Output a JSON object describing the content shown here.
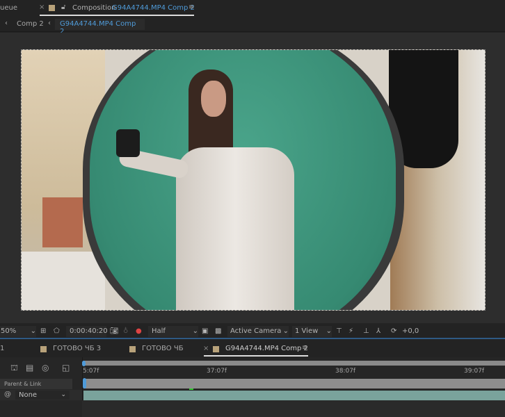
{
  "tabs": {
    "queue_partial": "ueue",
    "composition_label": "Composition",
    "composition_name": "G94A4744.MP4 Comp 2"
  },
  "breadcrumb": [
    {
      "label": "Comp 2"
    },
    {
      "label": "G94A4744.MP4 Comp 2"
    }
  ],
  "toolbar": {
    "zoom": "50%",
    "timecode": "0:00:40:20",
    "resolution": "Half",
    "camera": "Active Camera",
    "views": "1 View",
    "exposure": "+0,0"
  },
  "timeline_tabs": [
    {
      "label": "1"
    },
    {
      "label": "ГОТОВО ЧБ 3"
    },
    {
      "label": "ГОТОВО ЧБ"
    },
    {
      "label": "G94A4744.MP4 Comp 2",
      "active": true
    }
  ],
  "timeline": {
    "ruler": [
      "5:07f",
      "37:07f",
      "38:07f",
      "39:07f"
    ],
    "column_header": "Parent & Link",
    "parent_value": "None"
  },
  "colors": {
    "accent": "#4f9bd9",
    "label_swatch": "#b8a27a",
    "layer_bar": "#7aa39c",
    "green_screen": "#3e9a80"
  }
}
